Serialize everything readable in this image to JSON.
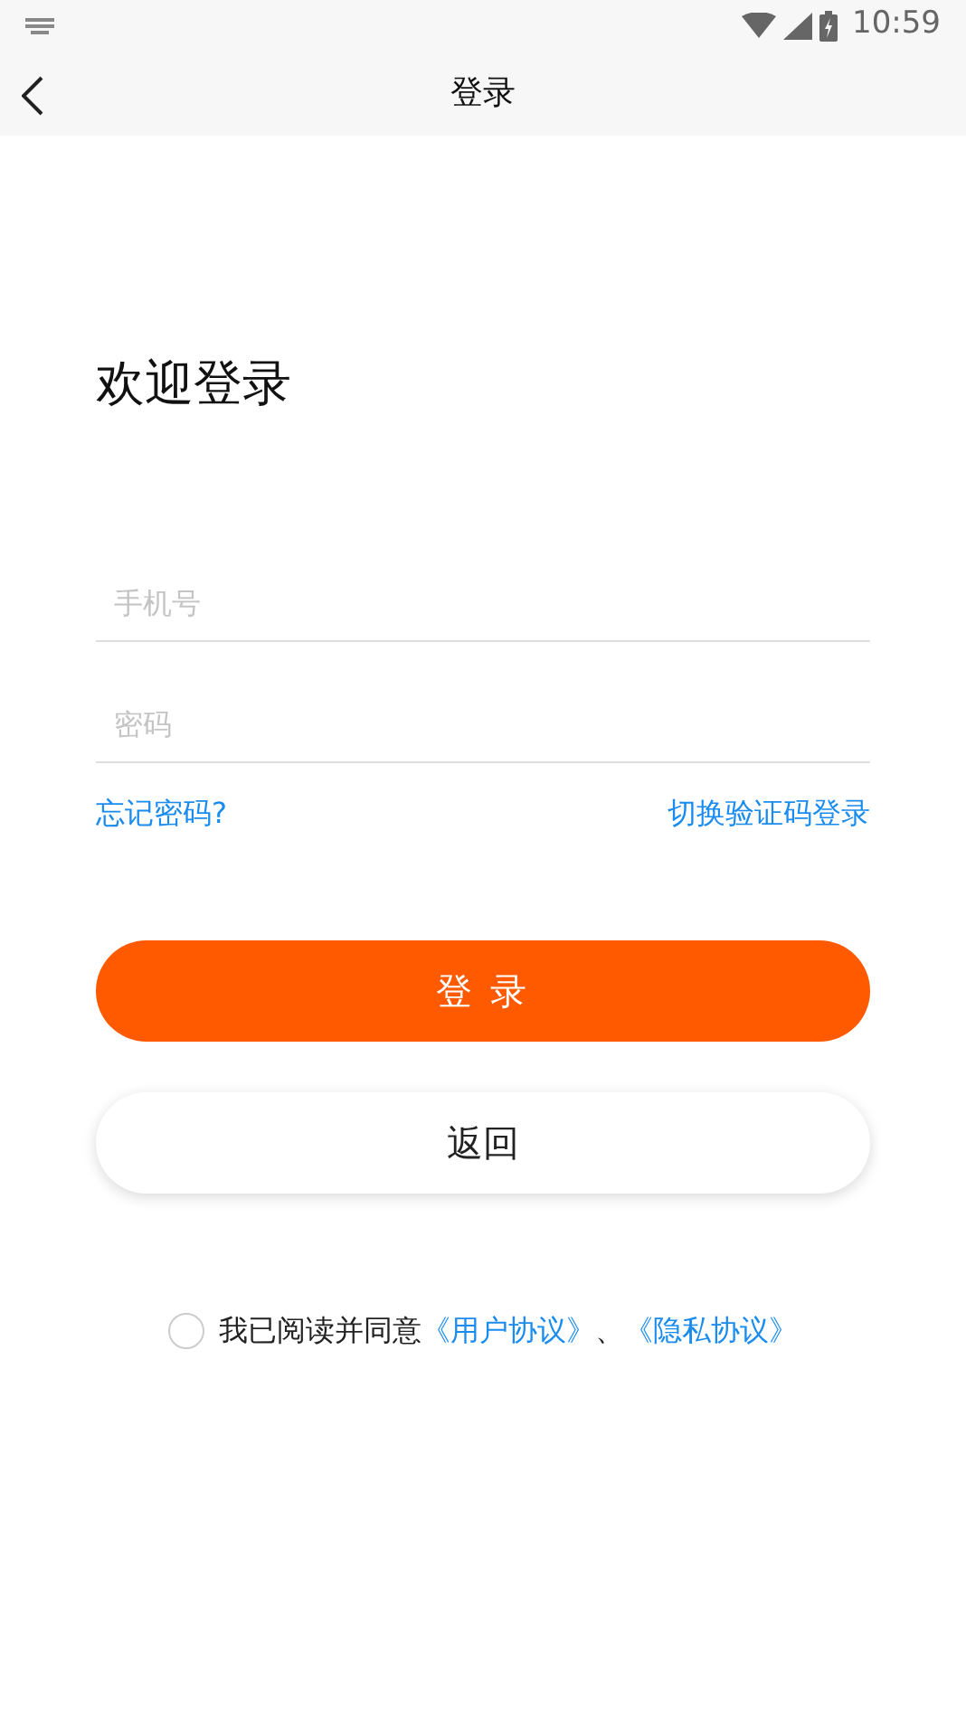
{
  "status_bar": {
    "time": "10:59"
  },
  "header": {
    "title": "登录"
  },
  "heading": "欢迎登录",
  "fields": [
    {
      "placeholder": "手机号"
    },
    {
      "placeholder": "密码"
    }
  ],
  "links": {
    "left": "忘记密码?",
    "right": "切换验证码登录"
  },
  "buttons": [
    {
      "label": "登 录",
      "kind": "primary"
    },
    {
      "label": "返回",
      "kind": "secondary"
    }
  ],
  "agreement": {
    "checked": false,
    "text": "我已阅读并同意",
    "links": [
      "《用户协议》",
      "《隐私协议》"
    ],
    "separator": "、"
  }
}
